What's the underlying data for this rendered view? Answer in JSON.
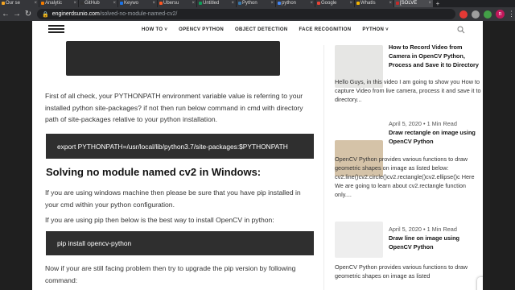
{
  "browser": {
    "tabs": [
      {
        "label": "Our se",
        "fav": "#f5a623"
      },
      {
        "label": "Analytic",
        "fav": "#f57c00"
      },
      {
        "label": "GitHub",
        "fav": "#333333"
      },
      {
        "label": "Keywo",
        "fav": "#1a73e8"
      },
      {
        "label": "Ubersu",
        "fav": "#ff5722"
      },
      {
        "label": "Untitled",
        "fav": "#0f9d58"
      },
      {
        "label": "Python",
        "fav": "#3776ab"
      },
      {
        "label": "python",
        "fav": "#4285f4"
      },
      {
        "label": "Google",
        "fav": "#ea4335"
      },
      {
        "label": "WhatIs",
        "fav": "#f4b400"
      },
      {
        "label": "[SOLVE",
        "fav": "#c62828"
      }
    ],
    "url_domain": "enginerdsunio.com",
    "url_path": "/solved-no-module-named-cv2/",
    "avatar_letter": "n"
  },
  "nav": {
    "items": [
      "HOW TO ˅",
      "OPENCV PYTHON",
      "OBJECT DETECTION",
      "FACE RECOGNITION",
      "PYTHON ˅"
    ]
  },
  "article": {
    "para1": "First of all check, your PYTHONPATH environment variable value is referring to your installed python site-packages? if not then run below command in cmd with directory path of site-packages relative to your python installation.",
    "code1": "export PYTHONPATH=/usr/local/lib/python3.7/site-packages:$PYTHONPATH",
    "heading": "Solving no module named cv2 in Windows:",
    "para2": "If you are using windows machine then please be sure that you have pip installed in your cmd within your python configuration.",
    "para3": "If you are using pip then below is the best way to install OpenCV in python:",
    "code2": "pip install opencv-python",
    "para4": "Now if your are still facing problem then try to upgrade the pip version by following command:"
  },
  "sidebar": {
    "post1": {
      "title": "How to Record Video from Camera in OpenCV Python, Process and Save it to Directory",
      "excerpt": "Hello Guys, in this video I am going to show you How to capture Video from live camera, process it and save it to directory..."
    },
    "post2": {
      "date": "April 5, 2020",
      "read": "1 Min Read",
      "title": "Draw rectangle on image using OpenCV Python",
      "excerpt": "OpenCV Python provides various functions to draw geometric shapes on image as listed below: cv2.line()cv2.circle()cv2.rectangle()cv2.ellipse()c Here We are going to learn about cv2.rectangle function only...."
    },
    "post3": {
      "date": "April 5, 2020",
      "read": "1 Min Read",
      "title": "Draw line on image using OpenCV Python",
      "excerpt": "OpenCV Python provides various functions to draw geometric shapes on image as listed"
    }
  }
}
